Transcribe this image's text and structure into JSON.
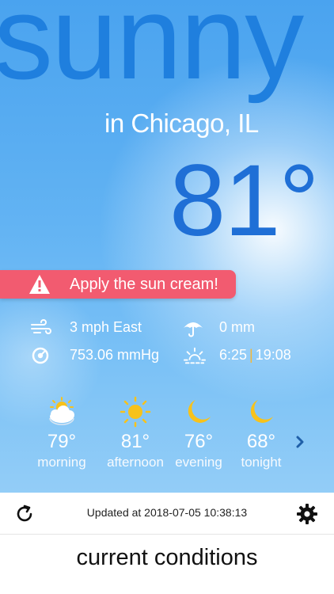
{
  "weather": {
    "condition": "sunny",
    "location": "in Chicago, IL",
    "temperature": "81°"
  },
  "alert": {
    "message": "Apply the sun cream!"
  },
  "stats": {
    "wind": "3 mph East",
    "precipitation": "0 mm",
    "pressure": "753.06 mmHg",
    "sunrise": "6:25",
    "sunset": "19:08"
  },
  "forecast": [
    {
      "temp": "79°",
      "label": "morning",
      "icon": "partly-cloudy-icon"
    },
    {
      "temp": "81°",
      "label": "afternoon",
      "icon": "sun-icon"
    },
    {
      "temp": "76°",
      "label": "evening",
      "icon": "moon-icon"
    },
    {
      "temp": "68°",
      "label": "tonight",
      "icon": "moon-icon"
    }
  ],
  "footer": {
    "updated": "Updated at 2018-07-05 10:38:13"
  },
  "caption": "current conditions",
  "colors": {
    "accent": "#1f7fde",
    "alert": "#f25b70",
    "sun": "#f7c21b"
  }
}
